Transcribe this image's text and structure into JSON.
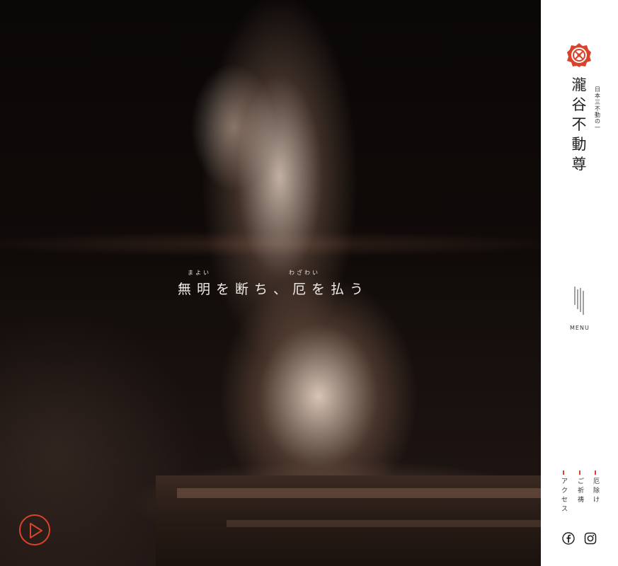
{
  "hero": {
    "catch_ruby_1": "まよい",
    "catch_ruby_2": "わざわい",
    "catch_text": "無明を断ち、厄を払う",
    "play_label": "play-video"
  },
  "sidebar": {
    "title": "瀧谷不動尊",
    "subtitle": "日本三不動の一",
    "menu_label": "MENU",
    "links": [
      {
        "label": "厄除け"
      },
      {
        "label": "ご祈祷"
      },
      {
        "label": "アクセス"
      }
    ],
    "social": [
      {
        "icon": "facebook-icon"
      },
      {
        "icon": "instagram-icon"
      }
    ]
  },
  "colors": {
    "accent": "#d9432b",
    "sidebar_bg": "#ffffff",
    "text_dark": "#222222"
  }
}
